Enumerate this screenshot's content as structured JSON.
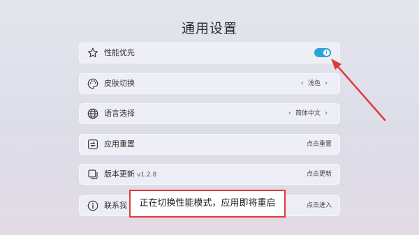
{
  "page": {
    "title": "通用设置"
  },
  "settings": {
    "performance": {
      "label": "性能优先",
      "icon": "star-icon",
      "toggle_on": true
    },
    "skin": {
      "label": "皮肤切换",
      "value": "浅色",
      "icon": "palette-icon"
    },
    "language": {
      "label": "语言选择",
      "value": "简体中文",
      "icon": "globe-icon"
    },
    "reset": {
      "label": "应用重置",
      "value": "点击重置",
      "icon": "refresh-icon"
    },
    "update": {
      "label": "版本更新",
      "version": "v1.2.8",
      "value": "点击更新",
      "icon": "copy-icon"
    },
    "contact": {
      "label": "联系我",
      "value": "点击进入",
      "icon": "info-icon"
    }
  },
  "toast": {
    "message": "正在切换性能模式，应用即将重启"
  },
  "colors": {
    "accent": "#2ba5d6",
    "annotation": "#e0393a"
  }
}
